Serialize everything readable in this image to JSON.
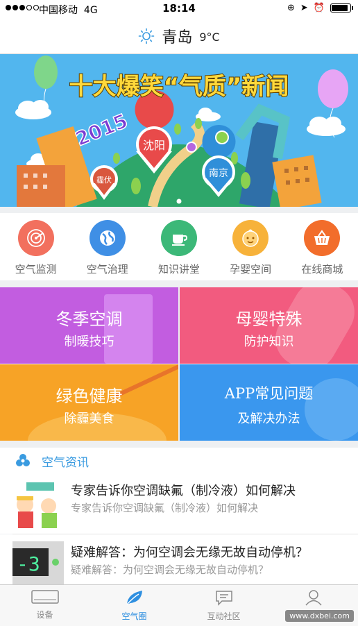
{
  "status_bar": {
    "carrier": "中国移动",
    "network": "4G",
    "time": "18:14"
  },
  "header": {
    "city": "青岛",
    "temperature": "9°C",
    "weather_icon": "sun-icon"
  },
  "banner": {
    "title": "十大爆笑“气质”新闻",
    "year": "2015",
    "pins": [
      "沈阳",
      "南京",
      "霾伏"
    ],
    "page_count": 1,
    "active_page": 1
  },
  "quick_nav": [
    {
      "label": "空气监测",
      "icon": "radar-icon",
      "color": "#f2705e"
    },
    {
      "label": "空气治理",
      "icon": "globe-icon",
      "color": "#3f8fe5"
    },
    {
      "label": "知识讲堂",
      "icon": "coffee-cup-icon",
      "color": "#3cb878"
    },
    {
      "label": "孕婴空间",
      "icon": "baby-face-icon",
      "color": "#f7b23a"
    },
    {
      "label": "在线商城",
      "icon": "shopping-basket-icon",
      "color": "#f26d2b"
    }
  ],
  "tiles": [
    {
      "title": "冬季空调",
      "subtitle": "制暖技巧",
      "color": "#c25de0"
    },
    {
      "title": "母婴特殊",
      "subtitle": "防护知识",
      "color": "#f25b7f"
    },
    {
      "title": "绿色健康",
      "subtitle": "除霾美食",
      "color": "#f7a326"
    },
    {
      "title": "APP常见问题",
      "subtitle": "及解决办法",
      "color": "#3a97ee"
    }
  ],
  "news": {
    "section_title": "空气资讯",
    "items": [
      {
        "title": "专家告诉你空调缺氟（制冷液）如何解决",
        "desc": "专家告诉你空调缺氟（制冷液）如何解决"
      },
      {
        "title": "疑难解答：为何空调会无缘无故自动停机？",
        "desc": "疑难解答：为何空调会无缘无故自动停机？"
      }
    ]
  },
  "tab_bar": [
    {
      "label": "设备",
      "icon": "device-icon"
    },
    {
      "label": "空气圈",
      "icon": "leaf-icon",
      "active": true
    },
    {
      "label": "互动社区",
      "icon": "chat-icon"
    },
    {
      "label": "",
      "icon": "user-icon"
    }
  ],
  "watermark": "www.dxbei.com"
}
